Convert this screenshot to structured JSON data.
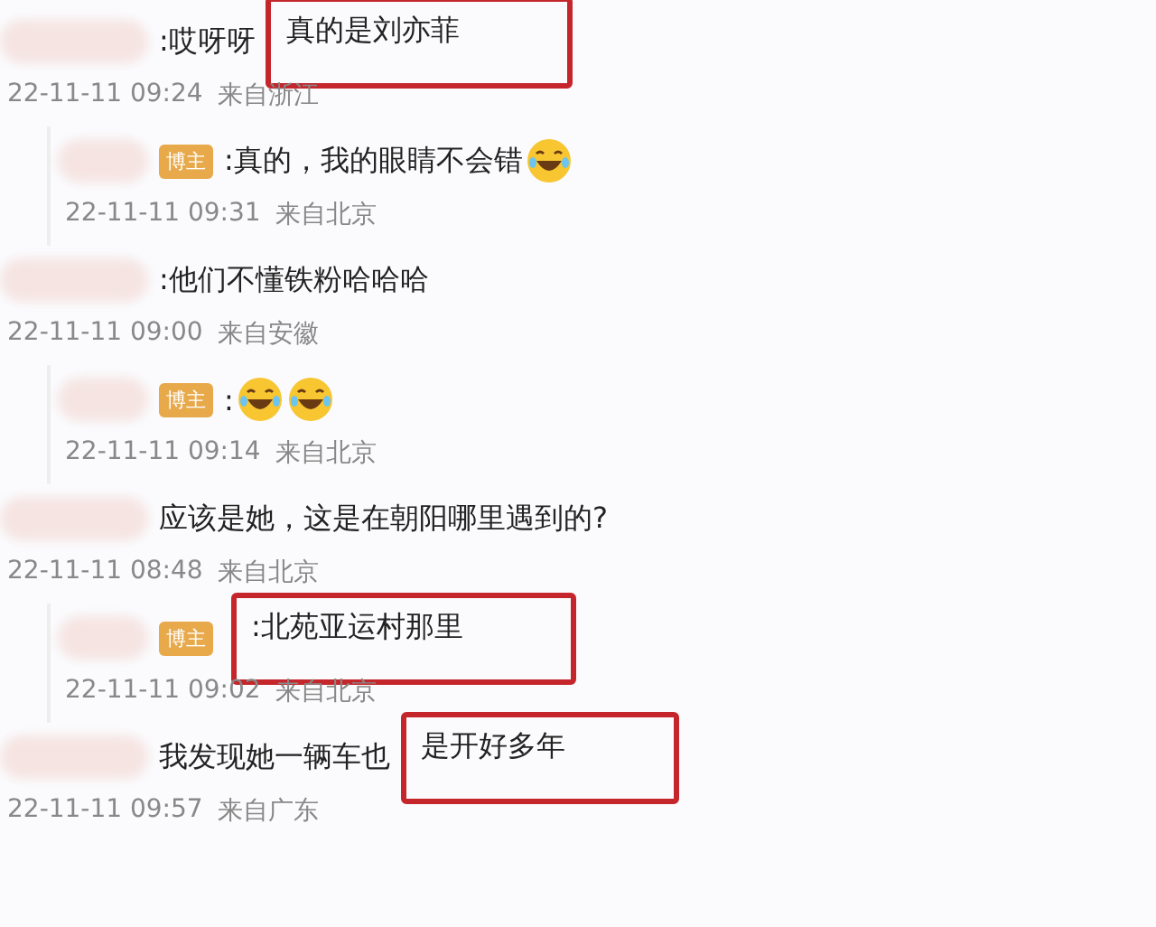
{
  "comments": [
    {
      "kind": "comment",
      "segments": [
        {
          "text": ":哎呀呀",
          "highlighted": false
        },
        {
          "text": "真的是刘亦菲",
          "highlighted": true
        }
      ],
      "time": "22-11-11 09:24",
      "location": "来自浙江"
    },
    {
      "kind": "reply",
      "badge": "博主",
      "segments": [
        {
          "text": ":真的，我的眼睛不会错",
          "highlighted": false
        }
      ],
      "emojis": [
        {
          "kind": "laugh"
        }
      ],
      "time": "22-11-11 09:31",
      "location": "来自北京"
    },
    {
      "kind": "comment",
      "segments": [
        {
          "text": ":他们不懂铁粉哈哈哈",
          "highlighted": false
        }
      ],
      "time": "22-11-11 09:00",
      "location": "来自安徽"
    },
    {
      "kind": "reply",
      "badge": "博主",
      "segments": [
        {
          "text": ":",
          "highlighted": false
        }
      ],
      "emojis": [
        {
          "kind": "laugh"
        },
        {
          "kind": "laugh"
        }
      ],
      "time": "22-11-11 09:14",
      "location": "来自北京"
    },
    {
      "kind": "comment",
      "segments": [
        {
          "text": "应该是她，这是在朝阳哪里遇到的?",
          "highlighted": false
        }
      ],
      "time": "22-11-11 08:48",
      "location": "来自北京"
    },
    {
      "kind": "reply",
      "badge": "博主",
      "segments": [
        {
          "text": ":北苑亚运村那里",
          "highlighted": true
        }
      ],
      "time": "22-11-11 09:02",
      "location": "来自北京"
    },
    {
      "kind": "comment",
      "segments": [
        {
          "text": "我发现她一辆车也",
          "highlighted": false
        },
        {
          "text": "是开好多年",
          "highlighted": true
        }
      ],
      "time": "22-11-11 09:57",
      "location": "来自广东"
    }
  ]
}
